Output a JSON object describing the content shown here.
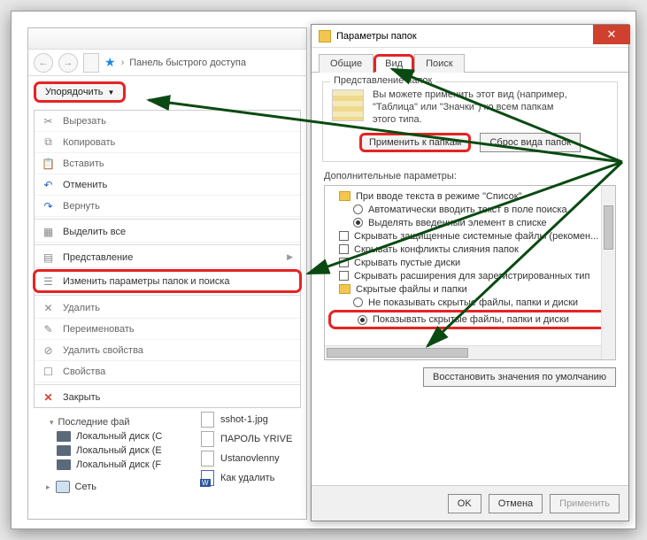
{
  "explorer": {
    "address": "Панель быстрого доступа",
    "organize_label": "Упорядочить",
    "menu": [
      {
        "icon": "scissors-icon",
        "label": "Вырезать",
        "dark": false
      },
      {
        "icon": "copy-icon",
        "label": "Копировать",
        "dark": false
      },
      {
        "icon": "paste-icon",
        "label": "Вставить",
        "dark": false
      },
      {
        "icon": "undo-icon",
        "label": "Отменить",
        "dark": true,
        "blue": true
      },
      {
        "icon": "redo-icon",
        "label": "Вернуть",
        "dark": false,
        "blue": true
      },
      {
        "sep": true
      },
      {
        "icon": "select-all-icon",
        "label": "Выделить все",
        "dark": true
      },
      {
        "sep": true
      },
      {
        "icon": "layout-icon",
        "label": "Представление",
        "dark": true,
        "arrow": true
      },
      {
        "icon": "folder-options-icon",
        "label": "Изменить параметры папок и поиска",
        "dark": true,
        "hilite": true
      },
      {
        "sep": true
      },
      {
        "icon": "delete-icon",
        "label": "Удалить",
        "dark": false
      },
      {
        "icon": "rename-icon",
        "label": "Переименовать",
        "dark": false
      },
      {
        "icon": "remove-props-icon",
        "label": "Удалить свойства",
        "dark": false
      },
      {
        "icon": "properties-icon",
        "label": "Свойства",
        "dark": false
      },
      {
        "sep": true
      },
      {
        "icon": "close-icon",
        "label": "Закрыть",
        "dark": true,
        "red": true
      }
    ],
    "tree": {
      "recent_label": "Последние фай",
      "drives": [
        "Локальный диск (C",
        "Локальный диск (E",
        "Локальный диск (F"
      ],
      "network": "Сеть"
    },
    "files": [
      "sshot-1.jpg",
      "ПАРОЛЬ YRIVE",
      "Ustanovlenny",
      "Как удалить"
    ]
  },
  "dialog": {
    "title": "Параметры папок",
    "tabs": {
      "general": "Общие",
      "view": "Вид",
      "search": "Поиск",
      "active": "view"
    },
    "folder_views": {
      "group": "Представление папок",
      "text1": "Вы можете применить этот вид (например,",
      "text2": "\"Таблица\" или \"Значки\") ко всем папкам",
      "text3": "этого типа.",
      "apply": "Применить к папкам",
      "reset": "Сброс вида папок"
    },
    "advanced": {
      "label": "Дополнительные параметры:",
      "items": [
        {
          "type": "folder",
          "indent": 0,
          "text": "При вводе текста в режиме \"Список\""
        },
        {
          "type": "radio",
          "indent": 1,
          "on": false,
          "text": "Автоматически вводить текст в поле поиска"
        },
        {
          "type": "radio",
          "indent": 1,
          "on": true,
          "text": "Выделять введенный элемент в списке"
        },
        {
          "type": "check",
          "indent": 0,
          "text": "Скрывать защищенные системные файлы (рекомен..."
        },
        {
          "type": "check",
          "indent": 0,
          "text": "Скрывать конфликты слияния папок"
        },
        {
          "type": "check",
          "indent": 0,
          "text": "Скрывать пустые диски"
        },
        {
          "type": "check",
          "indent": 0,
          "text": "Скрывать расширения для зарегистрированных тип"
        },
        {
          "type": "folder",
          "indent": 0,
          "text": "Скрытые файлы и папки"
        },
        {
          "type": "radio",
          "indent": 1,
          "on": false,
          "text": "Не показывать скрытые файлы, папки и диски"
        },
        {
          "type": "radio",
          "indent": 1,
          "on": true,
          "hilite": true,
          "text": "Показывать скрытые файлы, папки и диски"
        }
      ],
      "restore": "Восстановить значения по умолчанию"
    },
    "buttons": {
      "ok": "OK",
      "cancel": "Отмена",
      "apply": "Применить"
    }
  }
}
